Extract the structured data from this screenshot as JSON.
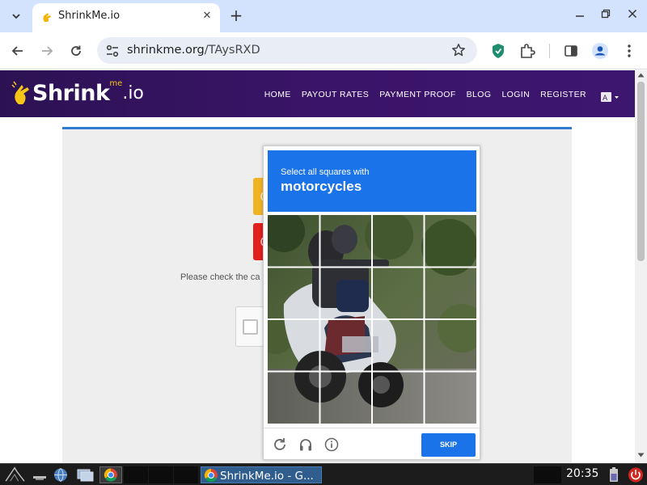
{
  "browser": {
    "tab_title": "ShrinkMe.io",
    "url_host": "shrinkme.org",
    "url_path": "/TAysRXD"
  },
  "site": {
    "logo_text": "Shrink",
    "logo_me": "me",
    "logo_io": ".io",
    "nav": [
      "HOME",
      "PAYOUT RATES",
      "PAYMENT PROOF",
      "BLOG",
      "LOGIN",
      "REGISTER"
    ],
    "check_text": "Please check the ca"
  },
  "captcha": {
    "instruction": "Select all squares with",
    "target": "motorcycles",
    "skip_label": "SKIP"
  },
  "taskbar": {
    "active_window": "ShrinkMe.io - G...",
    "clock": "20:35"
  },
  "colors": {
    "header_purple": "#3a1468",
    "captcha_blue": "#1a73e8",
    "accent_yellow": "#f0b323",
    "accent_red": "#e0201c"
  }
}
